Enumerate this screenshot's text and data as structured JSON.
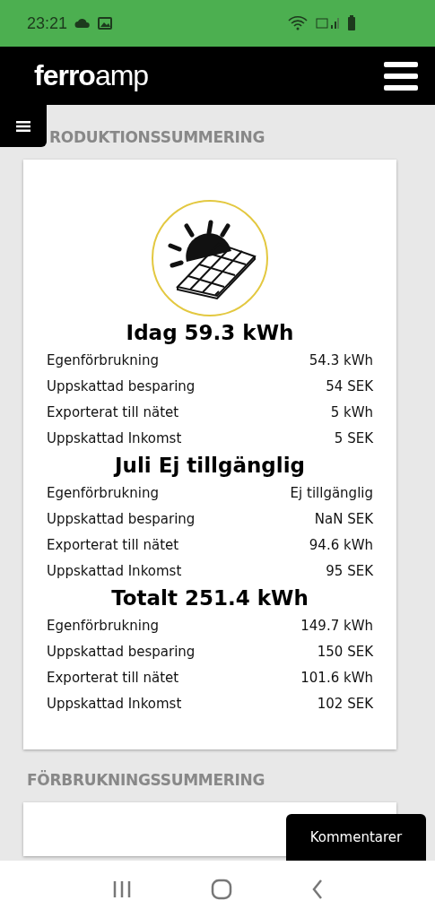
{
  "status_bar": {
    "time": "23:21"
  },
  "header": {
    "logo": "**ferro**amp"
  },
  "sections": [
    {
      "heading": "RODUKTIONSSUMMERING",
      "groups": [
        {
          "title": "Idag 59.3 kWh",
          "rows": [
            {
              "label": "Egenförbrukning",
              "value": "54.3 kWh"
            },
            {
              "label": "Uppskattad besparing",
              "value": "54 SEK"
            },
            {
              "label": "Exporterat till nätet",
              "value": "5 kWh"
            },
            {
              "label": "Uppskattad Inkomst",
              "value": "5 SEK"
            }
          ]
        },
        {
          "title": "Juli Ej tillgänglig",
          "rows": [
            {
              "label": "Egenförbrukning",
              "value": "Ej tillgänglig"
            },
            {
              "label": "Uppskattad besparing",
              "value": "NaN SEK"
            },
            {
              "label": "Exporterat till nätet",
              "value": "94.6 kWh"
            },
            {
              "label": "Uppskattad Inkomst",
              "value": "95 SEK"
            }
          ]
        },
        {
          "title": "Totalt 251.4 kWh",
          "rows": [
            {
              "label": "Egenförbrukning",
              "value": "149.7 kWh"
            },
            {
              "label": "Uppskattad besparing",
              "value": "150 SEK"
            },
            {
              "label": "Exporterat till nätet",
              "value": "101.6 kWh"
            },
            {
              "label": "Uppskattad Inkomst",
              "value": "102 SEK"
            }
          ]
        }
      ]
    },
    {
      "heading": "FÖRBRUKNINGSSUMMERING"
    }
  ],
  "comments_button": "Kommentarer"
}
